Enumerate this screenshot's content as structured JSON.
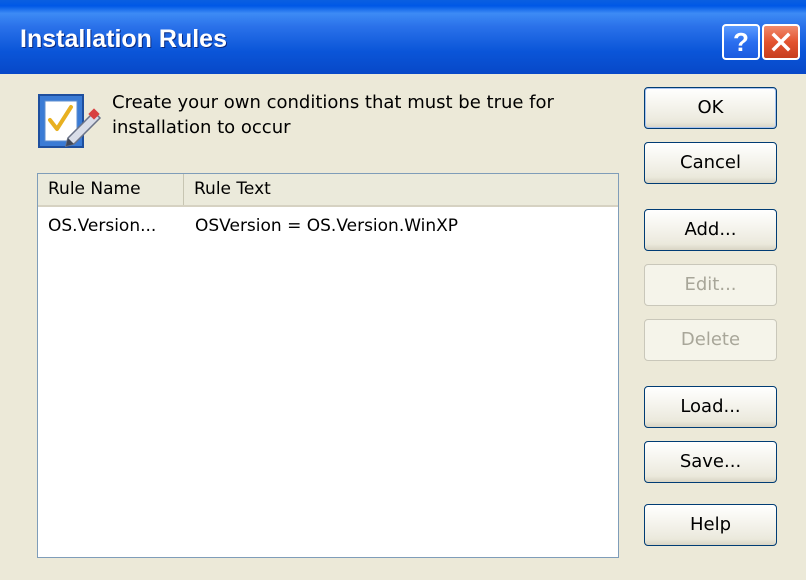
{
  "window": {
    "title": "Installation Rules"
  },
  "titlebar": {
    "help_label": "?",
    "close_icon": "close-icon"
  },
  "header": {
    "icon": "checklist-edit-icon",
    "description": "Create your own conditions that must be true for installation to occur"
  },
  "rules_list": {
    "columns": [
      "Rule Name",
      "Rule Text"
    ],
    "rows": [
      {
        "name": "OS.Version...",
        "text": "OSVersion = OS.Version.WinXP"
      }
    ]
  },
  "buttons": {
    "ok": "OK",
    "cancel": "Cancel",
    "add": "Add...",
    "edit": "Edit...",
    "delete": "Delete",
    "load": "Load...",
    "save": "Save...",
    "help": "Help"
  },
  "colors": {
    "titlebar": "#0a55d8",
    "dialog_background": "#ece9d8",
    "close_button": "#e3532f",
    "disabled_text": "#a8a699"
  }
}
